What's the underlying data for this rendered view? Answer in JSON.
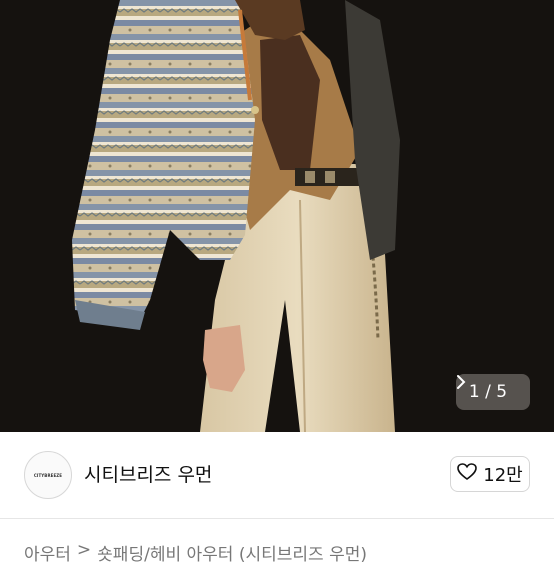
{
  "gallery": {
    "current": "1",
    "separator": "/",
    "total": "5",
    "next_icon": "chevron-right-icon"
  },
  "shop": {
    "logo_text": "CITYBREEZE",
    "name": "시티브리즈 우먼",
    "like_icon": "heart-icon",
    "like_count": "12만"
  },
  "breadcrumb": {
    "items": [
      "아우터",
      "숏패딩/헤비 아우터 (시티브리즈 우먼)"
    ],
    "separator": ">"
  }
}
